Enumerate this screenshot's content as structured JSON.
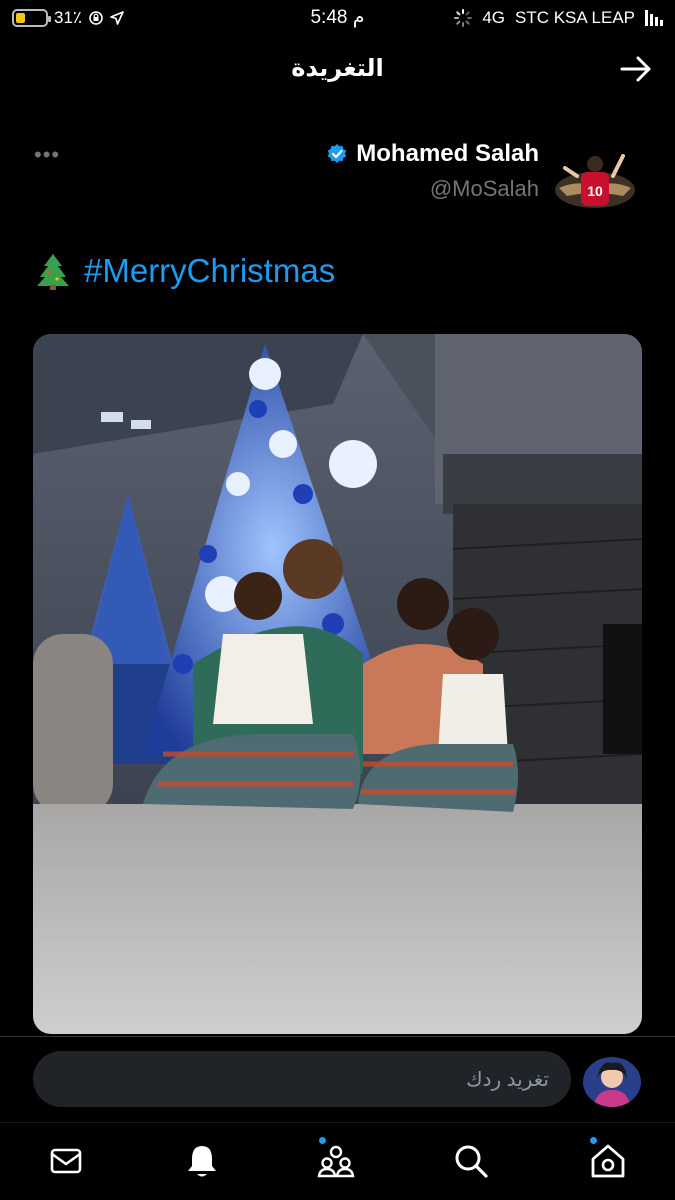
{
  "status_bar": {
    "battery": "31٪",
    "battery_level": 0.31,
    "time": "5:48 م",
    "network": "4G",
    "carrier": "STC KSA LEAP"
  },
  "header": {
    "title": "التغريدة"
  },
  "tweet": {
    "author_name": "Mohamed Salah",
    "author_handle": "@MoSalah",
    "emoji": "🎄",
    "hashtag": "#MerryChristmas"
  },
  "reply": {
    "placeholder": "تغريد ردك"
  },
  "icons": {
    "back": "arrow-right-icon",
    "more": "more-icon",
    "verified": "verified-badge-icon",
    "nav": [
      "mail-icon",
      "bell-icon",
      "communities-icon",
      "search-icon",
      "home-icon"
    ]
  },
  "colors": {
    "accent": "#1d9bf0",
    "background": "#000000",
    "secondary_text": "#71767b"
  }
}
